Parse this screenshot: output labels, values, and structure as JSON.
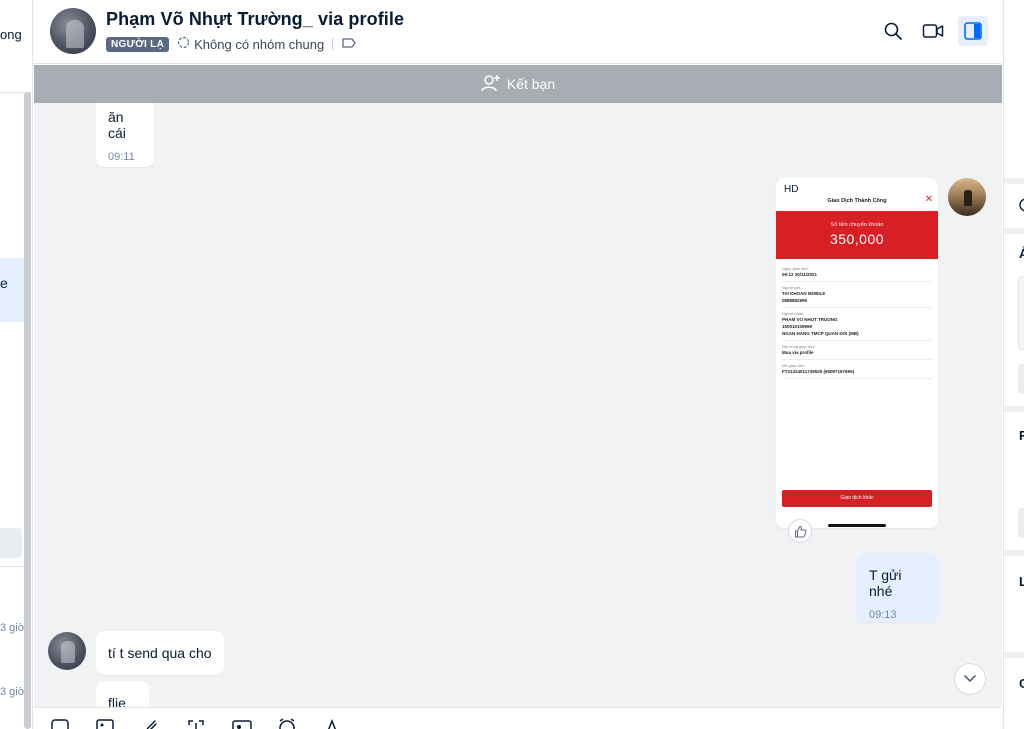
{
  "sidebar": {
    "fragment_top": "ong",
    "fragment_active": "e",
    "fragment_time_1": "3 giờ",
    "fragment_time_2": "3 giờ"
  },
  "header": {
    "title": "Phạm Võ Nhựt Trường_ via profile",
    "tag": "NGƯỜI LẠ",
    "group_text": "Không có nhóm chung",
    "icons": [
      "search-icon",
      "video-call-icon",
      "toggle-info-panel-icon"
    ]
  },
  "banner": {
    "add_friend": "Kết bạn"
  },
  "messages": [
    {
      "from": "them",
      "text": "ăn cái",
      "time": "09:11"
    },
    {
      "from": "me",
      "type": "image"
    },
    {
      "from": "me",
      "text": "T gửi nhé",
      "time": "09:13"
    },
    {
      "from": "them",
      "text": "tí t send qua cho"
    },
    {
      "from": "them",
      "text": "flie"
    }
  ],
  "receipt": {
    "corner_label": "HD",
    "title": "Giao Dịch Thành Công",
    "amount_label": "Số tiền chuyển khoản",
    "amount": "350,000",
    "rows": [
      {
        "key": "Ngày giao dịch",
        "value": "09:12 20/11/2021"
      },
      {
        "key": "Người gửi",
        "value": "TAI KHOAN MOBILE"
      },
      {
        "key": "",
        "value": "0888882995"
      },
      {
        "key": "Người nhận",
        "value": "PHAM VO NHUT TRUONG"
      },
      {
        "key": "",
        "value": "150010109999"
      },
      {
        "key": "",
        "value": "NGAN HANG TMCP QUAN DOI (MB)"
      },
      {
        "key": "Nội dung giao dịch",
        "value": "Mua via profile"
      },
      {
        "key": "Mã giao dịch",
        "value": "FT21324011749525 (65097167695)"
      }
    ],
    "button": "Giao dịch khác"
  },
  "toolbar": {
    "icons": [
      "sticker-icon",
      "image-icon",
      "attachment-icon",
      "screenshot-icon",
      "business-card-icon",
      "reminder-icon",
      "format-text-icon"
    ]
  },
  "right_panel": {
    "fragments": [
      "Ả",
      "F",
      "L",
      "C"
    ]
  },
  "colors": {
    "accent": "#0068ff",
    "banner": "#a7adb3",
    "chat_bg": "#f1f2f4",
    "my_bubble": "#e5efff",
    "receipt_red": "#d91f26"
  }
}
